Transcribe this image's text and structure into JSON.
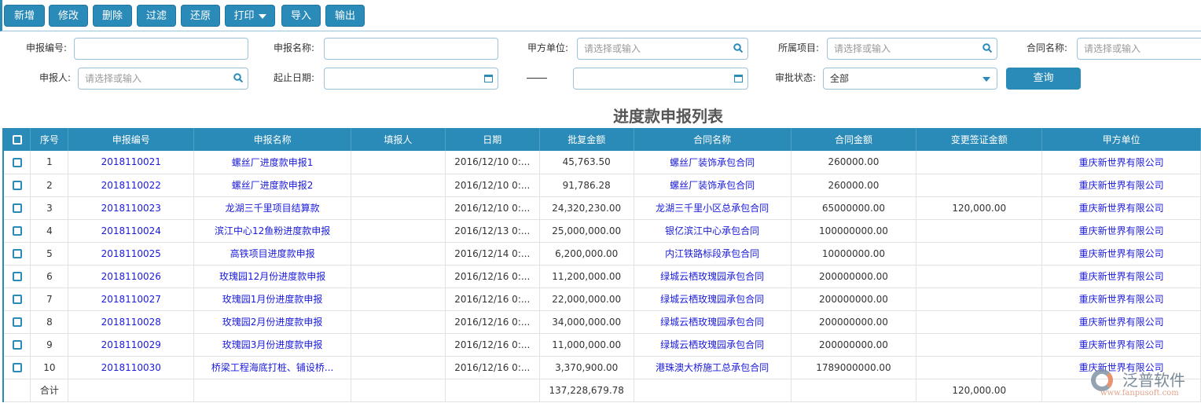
{
  "toolbar": {
    "buttons": [
      "新增",
      "修改",
      "删除",
      "过滤",
      "还原",
      "打印",
      "导入",
      "输出"
    ]
  },
  "filters": {
    "report_no": {
      "label": "申报编号:",
      "value": ""
    },
    "report_name": {
      "label": "申报名称:",
      "value": ""
    },
    "party_a": {
      "label": "甲方单位:",
      "placeholder": "请选择或输入"
    },
    "project": {
      "label": "所属项目:",
      "placeholder": "请选择或输入"
    },
    "contract": {
      "label": "合同名称:",
      "placeholder": "请选择或输入"
    },
    "reporter": {
      "label": "申报人:",
      "placeholder": "请选择或输入"
    },
    "date_range": {
      "label": "起止日期:",
      "separator": "——"
    },
    "status": {
      "label": "审批状态:",
      "value": "全部"
    },
    "query_label": "查询"
  },
  "title": "进度款申报列表",
  "table": {
    "headers": [
      "序号",
      "申报编号",
      "申报名称",
      "填报人",
      "日期",
      "批复金额",
      "合同名称",
      "合同金额",
      "变更签证金额",
      "甲方单位"
    ],
    "rows": [
      [
        "1",
        "2018110021",
        "螺丝厂进度款申报1",
        "",
        "2016/12/10 0:...",
        "45,763.50",
        "螺丝厂装饰承包合同",
        "260000.00",
        "",
        "重庆新世界有限公司"
      ],
      [
        "2",
        "2018110022",
        "螺丝厂进度款申报2",
        "",
        "2016/12/10 0:...",
        "91,786.28",
        "螺丝厂装饰承包合同",
        "260000.00",
        "",
        "重庆新世界有限公司"
      ],
      [
        "3",
        "2018110023",
        "龙湖三千里项目结算款",
        "",
        "2016/12/10 0:...",
        "24,320,230.00",
        "龙湖三千里小区总承包合同",
        "65000000.00",
        "120,000.00",
        "重庆新世界有限公司"
      ],
      [
        "4",
        "2018110024",
        "滨江中心12鱼粉进度款申报",
        "",
        "2016/12/13 0:...",
        "25,000,000.00",
        "银亿滨江中心承包合同",
        "100000000.00",
        "",
        "重庆新世界有限公司"
      ],
      [
        "5",
        "2018110025",
        "高铁项目进度款申报",
        "",
        "2016/12/14 0:...",
        "6,200,000.00",
        "内江铁路标段承包合同",
        "10000000.00",
        "",
        "重庆新世界有限公司"
      ],
      [
        "6",
        "2018110026",
        "玫瑰园12月份进度款申报",
        "",
        "2016/12/16 0:...",
        "11,200,000.00",
        "绿城云栖玫瑰园承包合同",
        "200000000.00",
        "",
        "重庆新世界有限公司"
      ],
      [
        "7",
        "2018110027",
        "玫瑰园1月份进度款申报",
        "",
        "2016/12/16 0:...",
        "22,000,000.00",
        "绿城云栖玫瑰园承包合同",
        "200000000.00",
        "",
        "重庆新世界有限公司"
      ],
      [
        "8",
        "2018110028",
        "玫瑰园2月份进度款申报",
        "",
        "2016/12/16 0:...",
        "34,000,000.00",
        "绿城云栖玫瑰园承包合同",
        "200000000.00",
        "",
        "重庆新世界有限公司"
      ],
      [
        "9",
        "2018110029",
        "玫瑰园3月份进度款申报",
        "",
        "2016/12/16 0:...",
        "11,000,000.00",
        "绿城云栖玫瑰园承包合同",
        "200000000.00",
        "",
        "重庆新世界有限公司"
      ],
      [
        "10",
        "2018110030",
        "桥梁工程海底打桩、铺设桥...",
        "",
        "2016/12/16 0:...",
        "3,370,900.00",
        "港珠澳大桥施工总承包合同",
        "1789000000.00",
        "",
        "重庆新世界有限公司"
      ]
    ],
    "footer": {
      "label": "合计",
      "approved_total": "137,228,679.78",
      "change_total": "120,000.00"
    }
  },
  "watermark": {
    "name": "泛普软件",
    "url": "www.fanpusoft.com"
  },
  "colors": {
    "primary": "#2a8ab8",
    "link": "#1a1adb"
  }
}
